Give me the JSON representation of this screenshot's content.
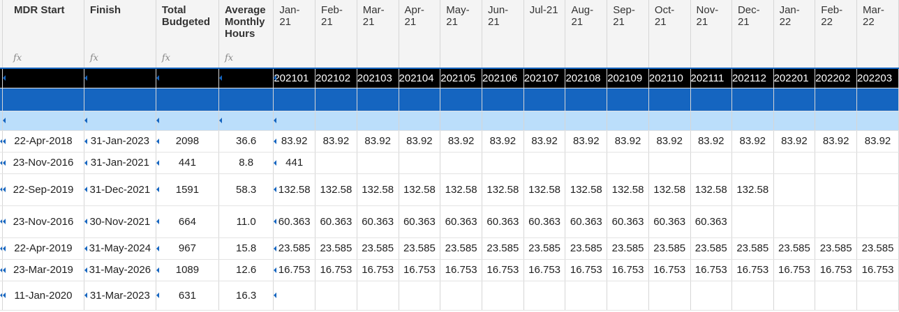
{
  "columns": {
    "mdr_start": "MDR Start",
    "finish": "Finish",
    "total_budgeted": "Total Budgeted",
    "avg_monthly_hours": "Average Monthly Hours",
    "formula_icon": "fx"
  },
  "months": [
    {
      "label": "Jan-21",
      "code": "202101"
    },
    {
      "label": "Feb-21",
      "code": "202102"
    },
    {
      "label": "Mar-21",
      "code": "202103"
    },
    {
      "label": "Apr-21",
      "code": "202104"
    },
    {
      "label": "May-21",
      "code": "202105"
    },
    {
      "label": "Jun-21",
      "code": "202106"
    },
    {
      "label": "Jul-21",
      "code": "202107"
    },
    {
      "label": "Aug-21",
      "code": "202108"
    },
    {
      "label": "Sep-21",
      "code": "202109"
    },
    {
      "label": "Oct-21",
      "code": "202110"
    },
    {
      "label": "Nov-21",
      "code": "202111"
    },
    {
      "label": "Dec-21",
      "code": "202112"
    },
    {
      "label": "Jan-22",
      "code": "202201"
    },
    {
      "label": "Feb-22",
      "code": "202202"
    },
    {
      "label": "Mar-22",
      "code": "202203"
    }
  ],
  "rows": [
    {
      "start": "22-Apr-2018",
      "finish": "31-Jan-2023",
      "total": "2098",
      "avg": "36.6",
      "vals": [
        "83.92",
        "83.92",
        "83.92",
        "83.92",
        "83.92",
        "83.92",
        "83.92",
        "83.92",
        "83.92",
        "83.92",
        "83.92",
        "83.92",
        "83.92",
        "83.92",
        "83.92"
      ]
    },
    {
      "start": "23-Nov-2016",
      "finish": "31-Jan-2021",
      "total": "441",
      "avg": "8.8",
      "vals": [
        "441",
        "",
        "",
        "",
        "",
        "",
        "",
        "",
        "",
        "",
        "",
        "",
        "",
        "",
        ""
      ]
    },
    {
      "start": "22-Sep-2019",
      "finish": "31-Dec-2021",
      "total": "1591",
      "avg": "58.3",
      "vals": [
        "132.58",
        "132.58",
        "132.58",
        "132.58",
        "132.58",
        "132.58",
        "132.58",
        "132.58",
        "132.58",
        "132.58",
        "132.58",
        "132.58",
        "",
        "",
        ""
      ]
    },
    {
      "start": "23-Nov-2016",
      "finish": "30-Nov-2021",
      "total": "664",
      "avg": "11.0",
      "vals": [
        "60.363",
        "60.363",
        "60.363",
        "60.363",
        "60.363",
        "60.363",
        "60.363",
        "60.363",
        "60.363",
        "60.363",
        "60.363",
        "",
        "",
        "",
        ""
      ]
    },
    {
      "start": "22-Apr-2019",
      "finish": "31-May-2024",
      "total": "967",
      "avg": "15.8",
      "vals": [
        "23.585",
        "23.585",
        "23.585",
        "23.585",
        "23.585",
        "23.585",
        "23.585",
        "23.585",
        "23.585",
        "23.585",
        "23.585",
        "23.585",
        "23.585",
        "23.585",
        "23.585"
      ]
    },
    {
      "start": "23-Mar-2019",
      "finish": "31-May-2026",
      "total": "1089",
      "avg": "12.6",
      "vals": [
        "16.753",
        "16.753",
        "16.753",
        "16.753",
        "16.753",
        "16.753",
        "16.753",
        "16.753",
        "16.753",
        "16.753",
        "16.753",
        "16.753",
        "16.753",
        "16.753",
        "16.753"
      ]
    },
    {
      "start": "11-Jan-2020",
      "finish": "31-Mar-2023",
      "total": "631",
      "avg": "16.3",
      "vals": [
        "",
        "",
        "",
        "",
        "",
        "",
        "",
        "",
        "",
        "",
        "",
        "",
        "",
        "",
        ""
      ]
    }
  ],
  "colors": {
    "accent": "#1565c0",
    "light_accent": "#bbdefb",
    "header_bg": "#f4f4f4",
    "band": "#000000"
  }
}
